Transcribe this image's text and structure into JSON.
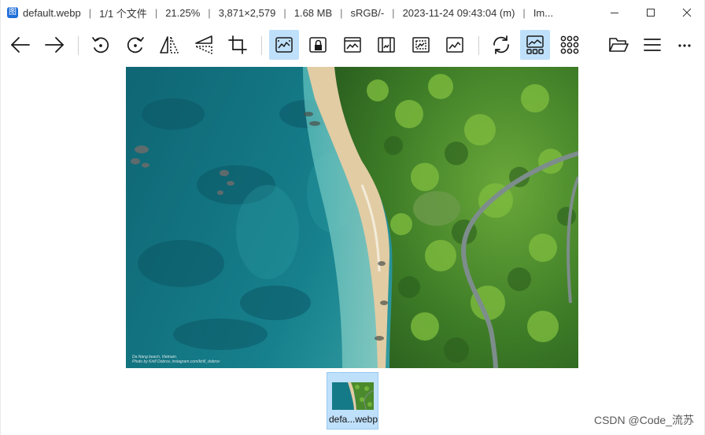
{
  "window": {
    "app_icon_glyph": "图",
    "filename": "default.webp",
    "index": "1/1 个文件",
    "zoom": "21.25%",
    "dimensions": "3,871×2,579",
    "filesize": "1.68 MB",
    "colorspace": "sRGB/-",
    "datetime": "2023-11-24 09:43:04 (m)",
    "more": "Im...",
    "separator": "|"
  },
  "toolbar": {
    "buttons": [
      {
        "name": "back",
        "icon": "arrow-left-icon"
      },
      {
        "name": "forward",
        "icon": "arrow-right-icon"
      },
      {
        "name": "rotate-left",
        "icon": "rotate-ccw-icon"
      },
      {
        "name": "rotate-right",
        "icon": "rotate-cw-icon"
      },
      {
        "name": "flip-horizontal",
        "icon": "flip-horizontal-icon"
      },
      {
        "name": "flip-vertical",
        "icon": "flip-vertical-icon"
      },
      {
        "name": "crop",
        "icon": "crop-icon"
      },
      {
        "name": "auto-zoom",
        "icon": "fit-zoom-icon",
        "active": true
      },
      {
        "name": "lock-zoom",
        "icon": "lock-zoom-icon"
      },
      {
        "name": "scale-to-width",
        "icon": "fit-width-icon"
      },
      {
        "name": "scale-to-height",
        "icon": "fit-height-icon"
      },
      {
        "name": "scale-to-fit",
        "icon": "fit-window-icon"
      },
      {
        "name": "scale-to-fill",
        "icon": "fill-window-icon"
      },
      {
        "name": "refresh",
        "icon": "refresh-icon"
      },
      {
        "name": "gallery",
        "icon": "gallery-icon",
        "active": true
      },
      {
        "name": "grid",
        "icon": "grid-icon"
      },
      {
        "name": "open-file",
        "icon": "folder-open-icon"
      },
      {
        "name": "main-menu",
        "icon": "hamburger-menu-icon"
      },
      {
        "name": "more",
        "icon": "more-icon"
      }
    ]
  },
  "image": {
    "caption_line1": "Da Nang beach, Vietnam.",
    "caption_line2": "Photo by Kirill Dobrov, instagram.com/kirill_dobrov"
  },
  "thumbnails": [
    {
      "label": "defa...webp",
      "selected": true
    }
  ],
  "watermark": "CSDN @Code_流苏",
  "colors": {
    "accent": "#bfe0fb",
    "accent_border": "#99c9f0",
    "icon": "#1a1a1a",
    "sea_deep": "#0f6e7c",
    "sea_shallow": "#3fa5a8",
    "sand": "#e2cca4",
    "forest": "#3d7a25",
    "road": "#7d8d8b"
  }
}
